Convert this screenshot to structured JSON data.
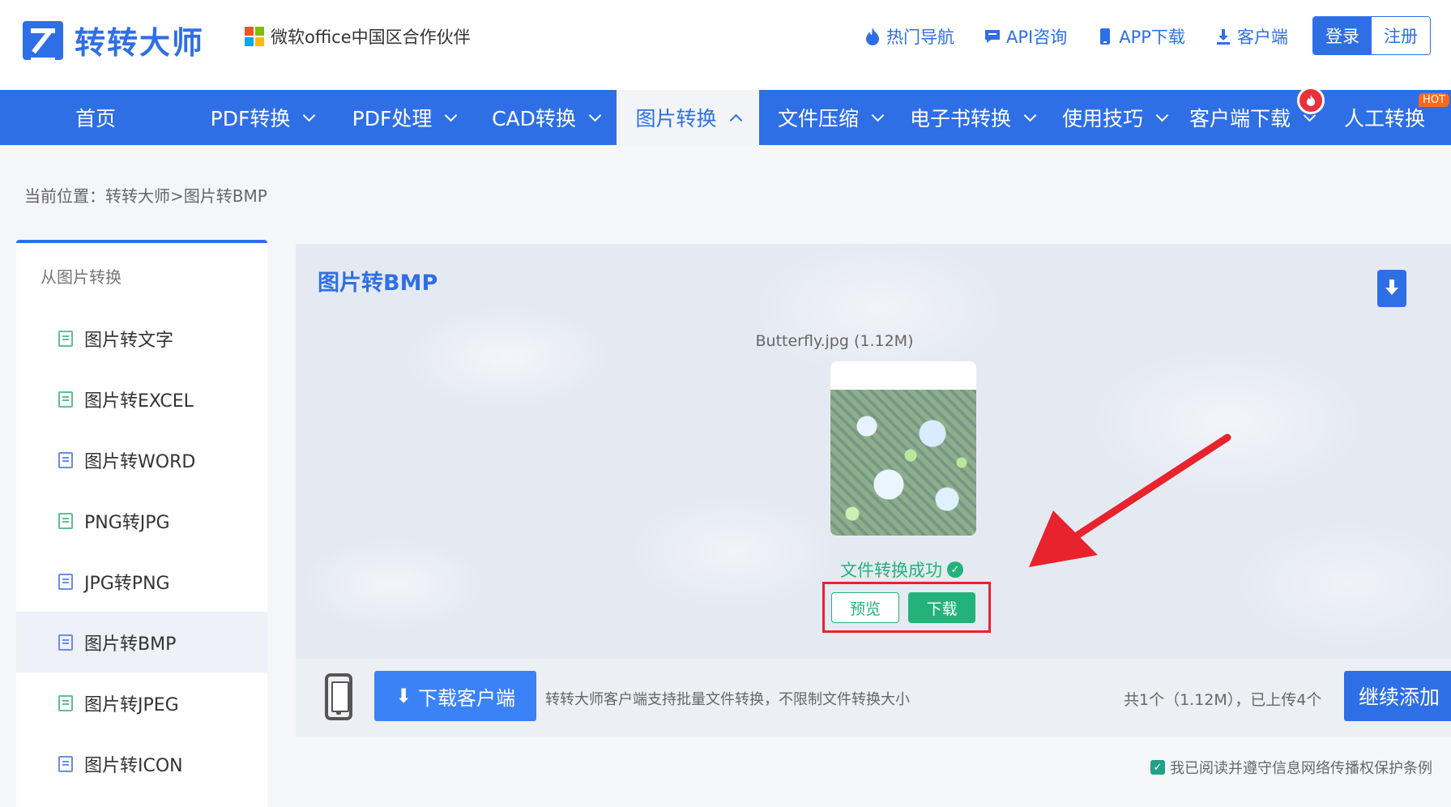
{
  "header": {
    "logo_text": "转转大师",
    "partner_text": "微软office中国区合作伙伴",
    "links": [
      {
        "label": "热门导航",
        "icon": "fire-icon"
      },
      {
        "label": "API咨询",
        "icon": "chat-icon"
      },
      {
        "label": "APP下载",
        "icon": "phone-icon"
      },
      {
        "label": "客户端",
        "icon": "download-icon"
      }
    ],
    "login": "登录",
    "register": "注册"
  },
  "nav": {
    "items": [
      {
        "label": "首页"
      },
      {
        "label": "PDF转换"
      },
      {
        "label": "PDF处理"
      },
      {
        "label": "CAD转换"
      },
      {
        "label": "图片转换"
      },
      {
        "label": "文件压缩"
      },
      {
        "label": "电子书转换"
      },
      {
        "label": "使用技巧"
      },
      {
        "label": "客户端下载"
      },
      {
        "label": "人工转换"
      }
    ],
    "hot_badge": "HOT"
  },
  "breadcrumb": "当前位置：转转大师>图片转BMP",
  "sidebar": {
    "heading": "从图片转换",
    "items": [
      {
        "label": "图片转文字"
      },
      {
        "label": "图片转EXCEL"
      },
      {
        "label": "图片转WORD"
      },
      {
        "label": "PNG转JPG"
      },
      {
        "label": "JPG转PNG"
      },
      {
        "label": "图片转BMP"
      },
      {
        "label": "图片转JPEG"
      },
      {
        "label": "图片转ICON"
      }
    ]
  },
  "main": {
    "title": "图片转BMP",
    "file_name": "Butterfly.jpg (1.12M)",
    "success_text": "文件转换成功",
    "preview_label": "预览",
    "download_label": "下载"
  },
  "bottom": {
    "client_button": "下载客户端",
    "client_tip": "转转大师客户端支持批量文件转换，不限制文件转换大小",
    "count_text": "共1个（1.12M），已上传4个",
    "add_more": "继续添加"
  },
  "agreement": "我已阅读并遵守信息网络传播权保护条例",
  "colors": {
    "brand": "#2f6fe6",
    "success": "#23b27a",
    "highlight": "#e8232d"
  }
}
